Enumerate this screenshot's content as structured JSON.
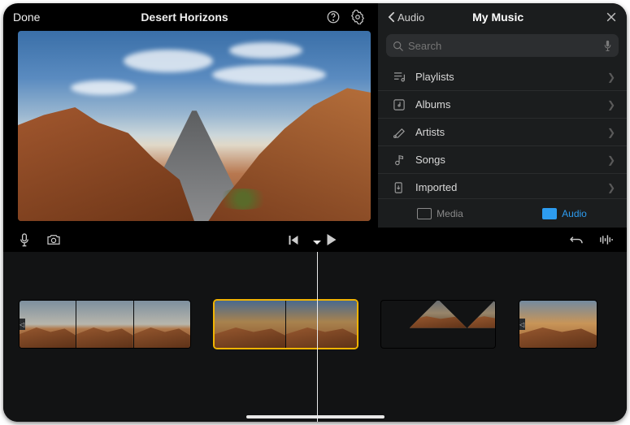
{
  "header": {
    "done": "Done",
    "title": "Desert Horizons"
  },
  "panel": {
    "back": "Audio",
    "title": "My Music",
    "search_placeholder": "Search",
    "items": [
      {
        "label": "Playlists",
        "icon": "playlists"
      },
      {
        "label": "Albums",
        "icon": "albums"
      },
      {
        "label": "Artists",
        "icon": "artists"
      },
      {
        "label": "Songs",
        "icon": "songs"
      },
      {
        "label": "Imported",
        "icon": "imported"
      }
    ],
    "tabs": {
      "media": "Media",
      "audio": "Audio"
    }
  }
}
